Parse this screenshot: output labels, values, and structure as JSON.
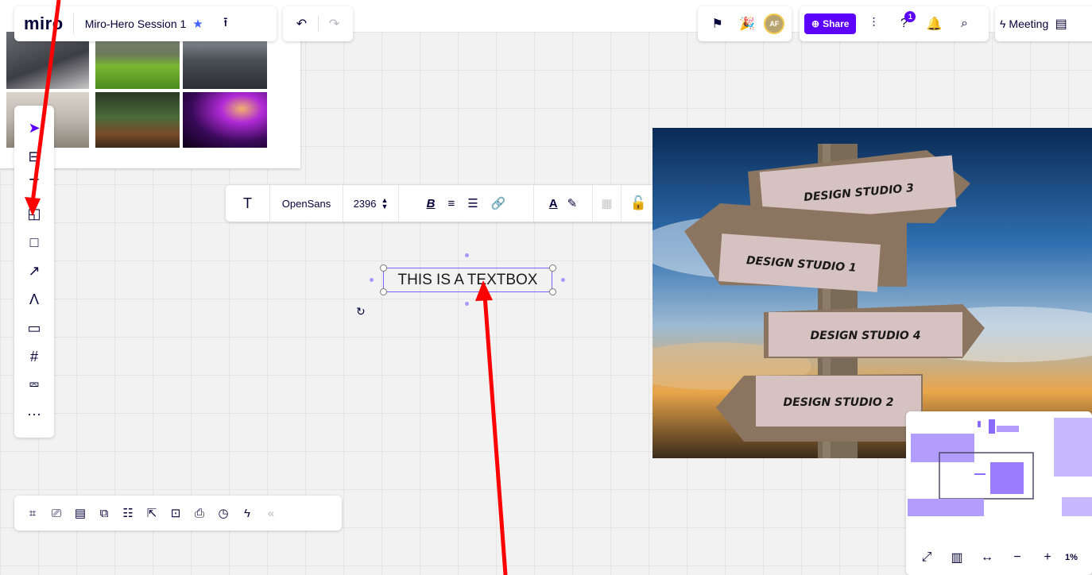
{
  "app": {
    "logo": "miro",
    "board_name": "Miro-Hero Session 1",
    "star_icon": "★",
    "upload_icon": "⭱"
  },
  "history": {
    "undo_icon": "↶",
    "redo_icon": "↷"
  },
  "collab": {
    "avatar_initials": "AF"
  },
  "share": {
    "share_label": "Share",
    "help_badge": "1"
  },
  "meeting": {
    "label": "Meeting"
  },
  "left_toolbar": [
    "select-icon",
    "templates-icon",
    "text-icon",
    "sticky-note-icon",
    "shape-icon",
    "arrow-icon",
    "pen-icon",
    "comment-icon",
    "frame-icon",
    "upload-icon",
    "more-icon"
  ],
  "format_toolbar": {
    "text_icon": "T",
    "font": "OpenSans",
    "font_size": "2396",
    "bold": "B"
  },
  "textbox": {
    "text": "THIS IS A TEXTBOX"
  },
  "signpost": {
    "signs": [
      "DESIGN STUDIO 3",
      "DESIGN STUDIO 1",
      "DESIGN STUDIO 4",
      "DESIGN STUDIO 2"
    ]
  },
  "minimap": {
    "zoom": "1%"
  },
  "colors": {
    "accent": "#5c00ff",
    "selection": "#7a63ff",
    "annotation": "#ff0000"
  }
}
